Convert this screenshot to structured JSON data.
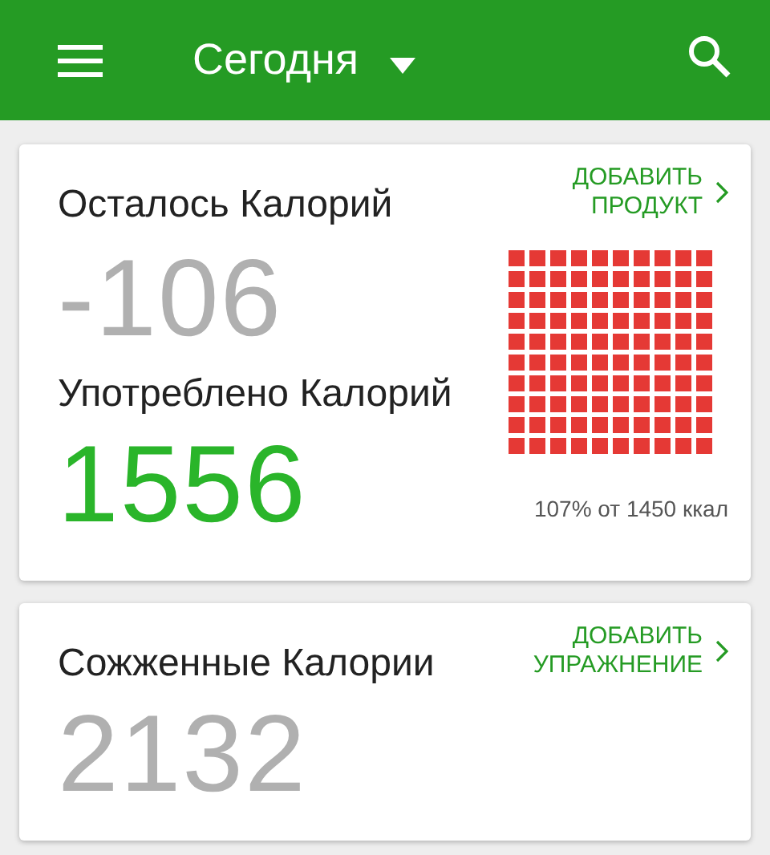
{
  "app_bar": {
    "title": "Сегодня"
  },
  "calories_card": {
    "remaining_label": "Осталось Калорий",
    "remaining_value": "-106",
    "consumed_label": "Употреблено Калорий",
    "consumed_value": "1556",
    "add_link": "ДОБАВИТЬ\nПРОДУКТ",
    "caption": "107% от 1450 ккал"
  },
  "burned_card": {
    "label": "Сожженные Калории",
    "value": "2132",
    "add_link": "ДОБАВИТЬ\nУПРАЖНЕНИЕ"
  }
}
